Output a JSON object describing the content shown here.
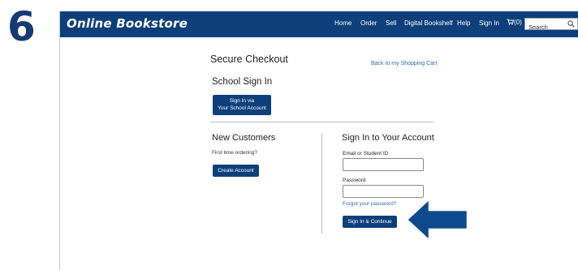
{
  "step": {
    "number": "6"
  },
  "navbar": {
    "brand": "Online Bookstore",
    "items": [
      "Home",
      "Order",
      "Sell",
      "Digital Bookshelf",
      "Help",
      "Sign In"
    ],
    "cart_label": "(0)",
    "cart_icon": "cart-icon",
    "search_placeholder": "Search",
    "search_icon": "search-icon"
  },
  "checkout": {
    "title": "Secure Checkout",
    "back_link": "Back to my Shopping Cart"
  },
  "school": {
    "title": "School Sign In",
    "button_line1": "Sign In via",
    "button_line2": "Your School Account"
  },
  "new_customers": {
    "title": "New Customers",
    "text": "First time ordering?",
    "button": "Create Account"
  },
  "sign_in": {
    "title": "Sign In to Your Account",
    "email_label": "Email or Student ID",
    "email_value": "",
    "password_label": "Password",
    "password_value": "",
    "forgot_link": "Forgot your password?",
    "button": "Sign In & Continue"
  },
  "callout": {
    "icon": "arrow-left-icon",
    "color": "#0d4a8c"
  }
}
